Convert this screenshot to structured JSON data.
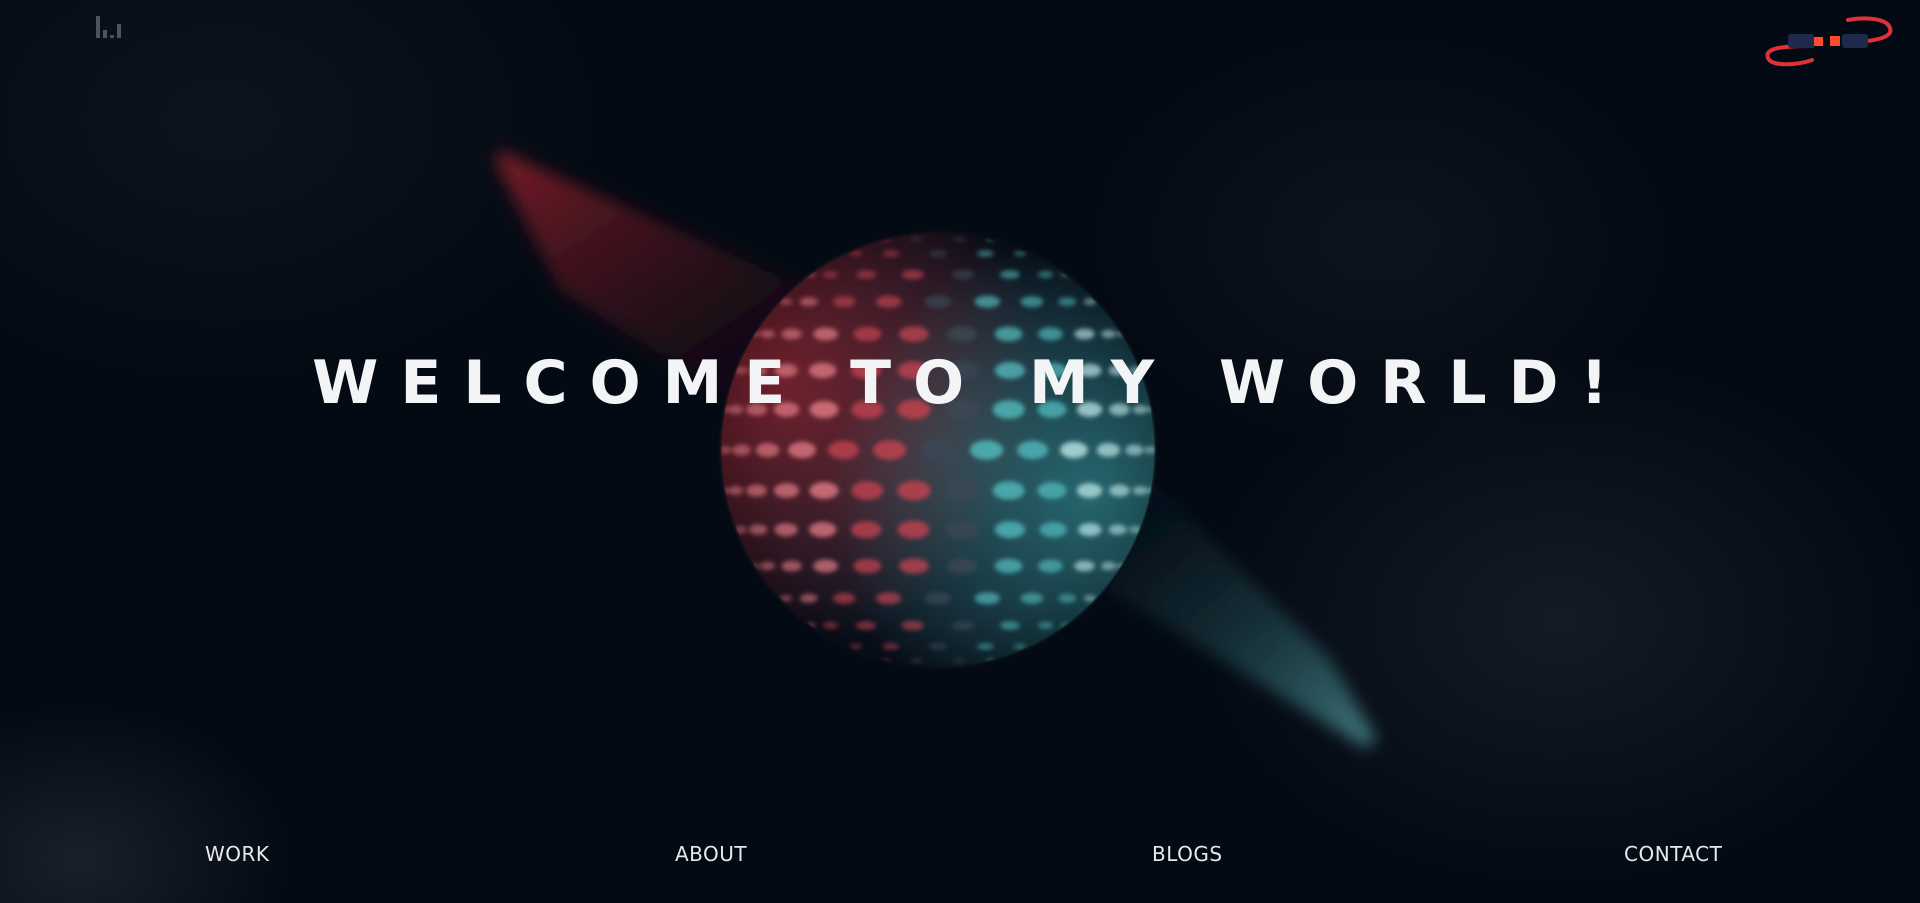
{
  "hero": {
    "headline": "WELCOME TO MY WORLD!"
  },
  "header": {
    "logo_icon": "sound-bars-icon",
    "plug_icon": "plug-connector-icon"
  },
  "nav": {
    "items": [
      {
        "label": "WORK"
      },
      {
        "label": "ABOUT"
      },
      {
        "label": "BLOGS"
      },
      {
        "label": "CONTACT"
      }
    ]
  },
  "colors": {
    "background": "#040a14",
    "headline": "#f2f4f6",
    "nav_text": "#e6e9ec",
    "accent_red": "#e0303a",
    "accent_teal": "#3fb6b9",
    "logo_gray": "#4a5561"
  }
}
